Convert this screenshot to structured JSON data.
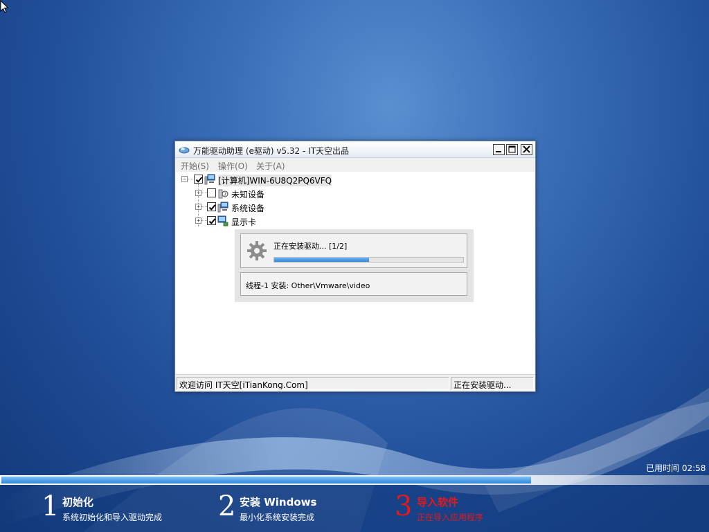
{
  "window": {
    "title": "万能驱动助理 (e驱动) v5.32 - IT天空出品",
    "menu": [
      "开始(S)",
      "操作(O)",
      "关于(A)"
    ]
  },
  "tree": {
    "root": "[计算机]WIN-6U8Q2PQ6VFQ",
    "children": [
      "未知设备",
      "系统设备",
      "显示卡"
    ],
    "checked": [
      true,
      false,
      true,
      true
    ]
  },
  "install": {
    "status": "正在安装驱动...  [1/2]",
    "progress": 0.5,
    "thread": "线程-1 安装:  Other\\Vmware\\video"
  },
  "statusbar": {
    "left": "欢迎访问 IT天空[iTianKong.Com]",
    "right": "正在安装驱动..."
  },
  "setup": {
    "elapsed": "已用时间 02:58",
    "progress": 0.75,
    "steps": [
      {
        "num": "1",
        "title": "初始化",
        "sub": "系统初始化和导入驱动完成"
      },
      {
        "num": "2",
        "title": "安装 Windows",
        "sub": "最小化系统安装完成"
      },
      {
        "num": "3",
        "title": "导入软件",
        "sub": "正在导入应用程序"
      }
    ]
  },
  "colors": {
    "active_step": "#e3191b",
    "progress_fill": "#2f87da"
  },
  "icons": [
    "cursor-icon",
    "app-logo-icon",
    "minimize-icon",
    "maximize-icon",
    "close-icon",
    "computer-icon",
    "unknown-device-icon",
    "system-device-icon",
    "display-card-icon",
    "gear-icon"
  ]
}
